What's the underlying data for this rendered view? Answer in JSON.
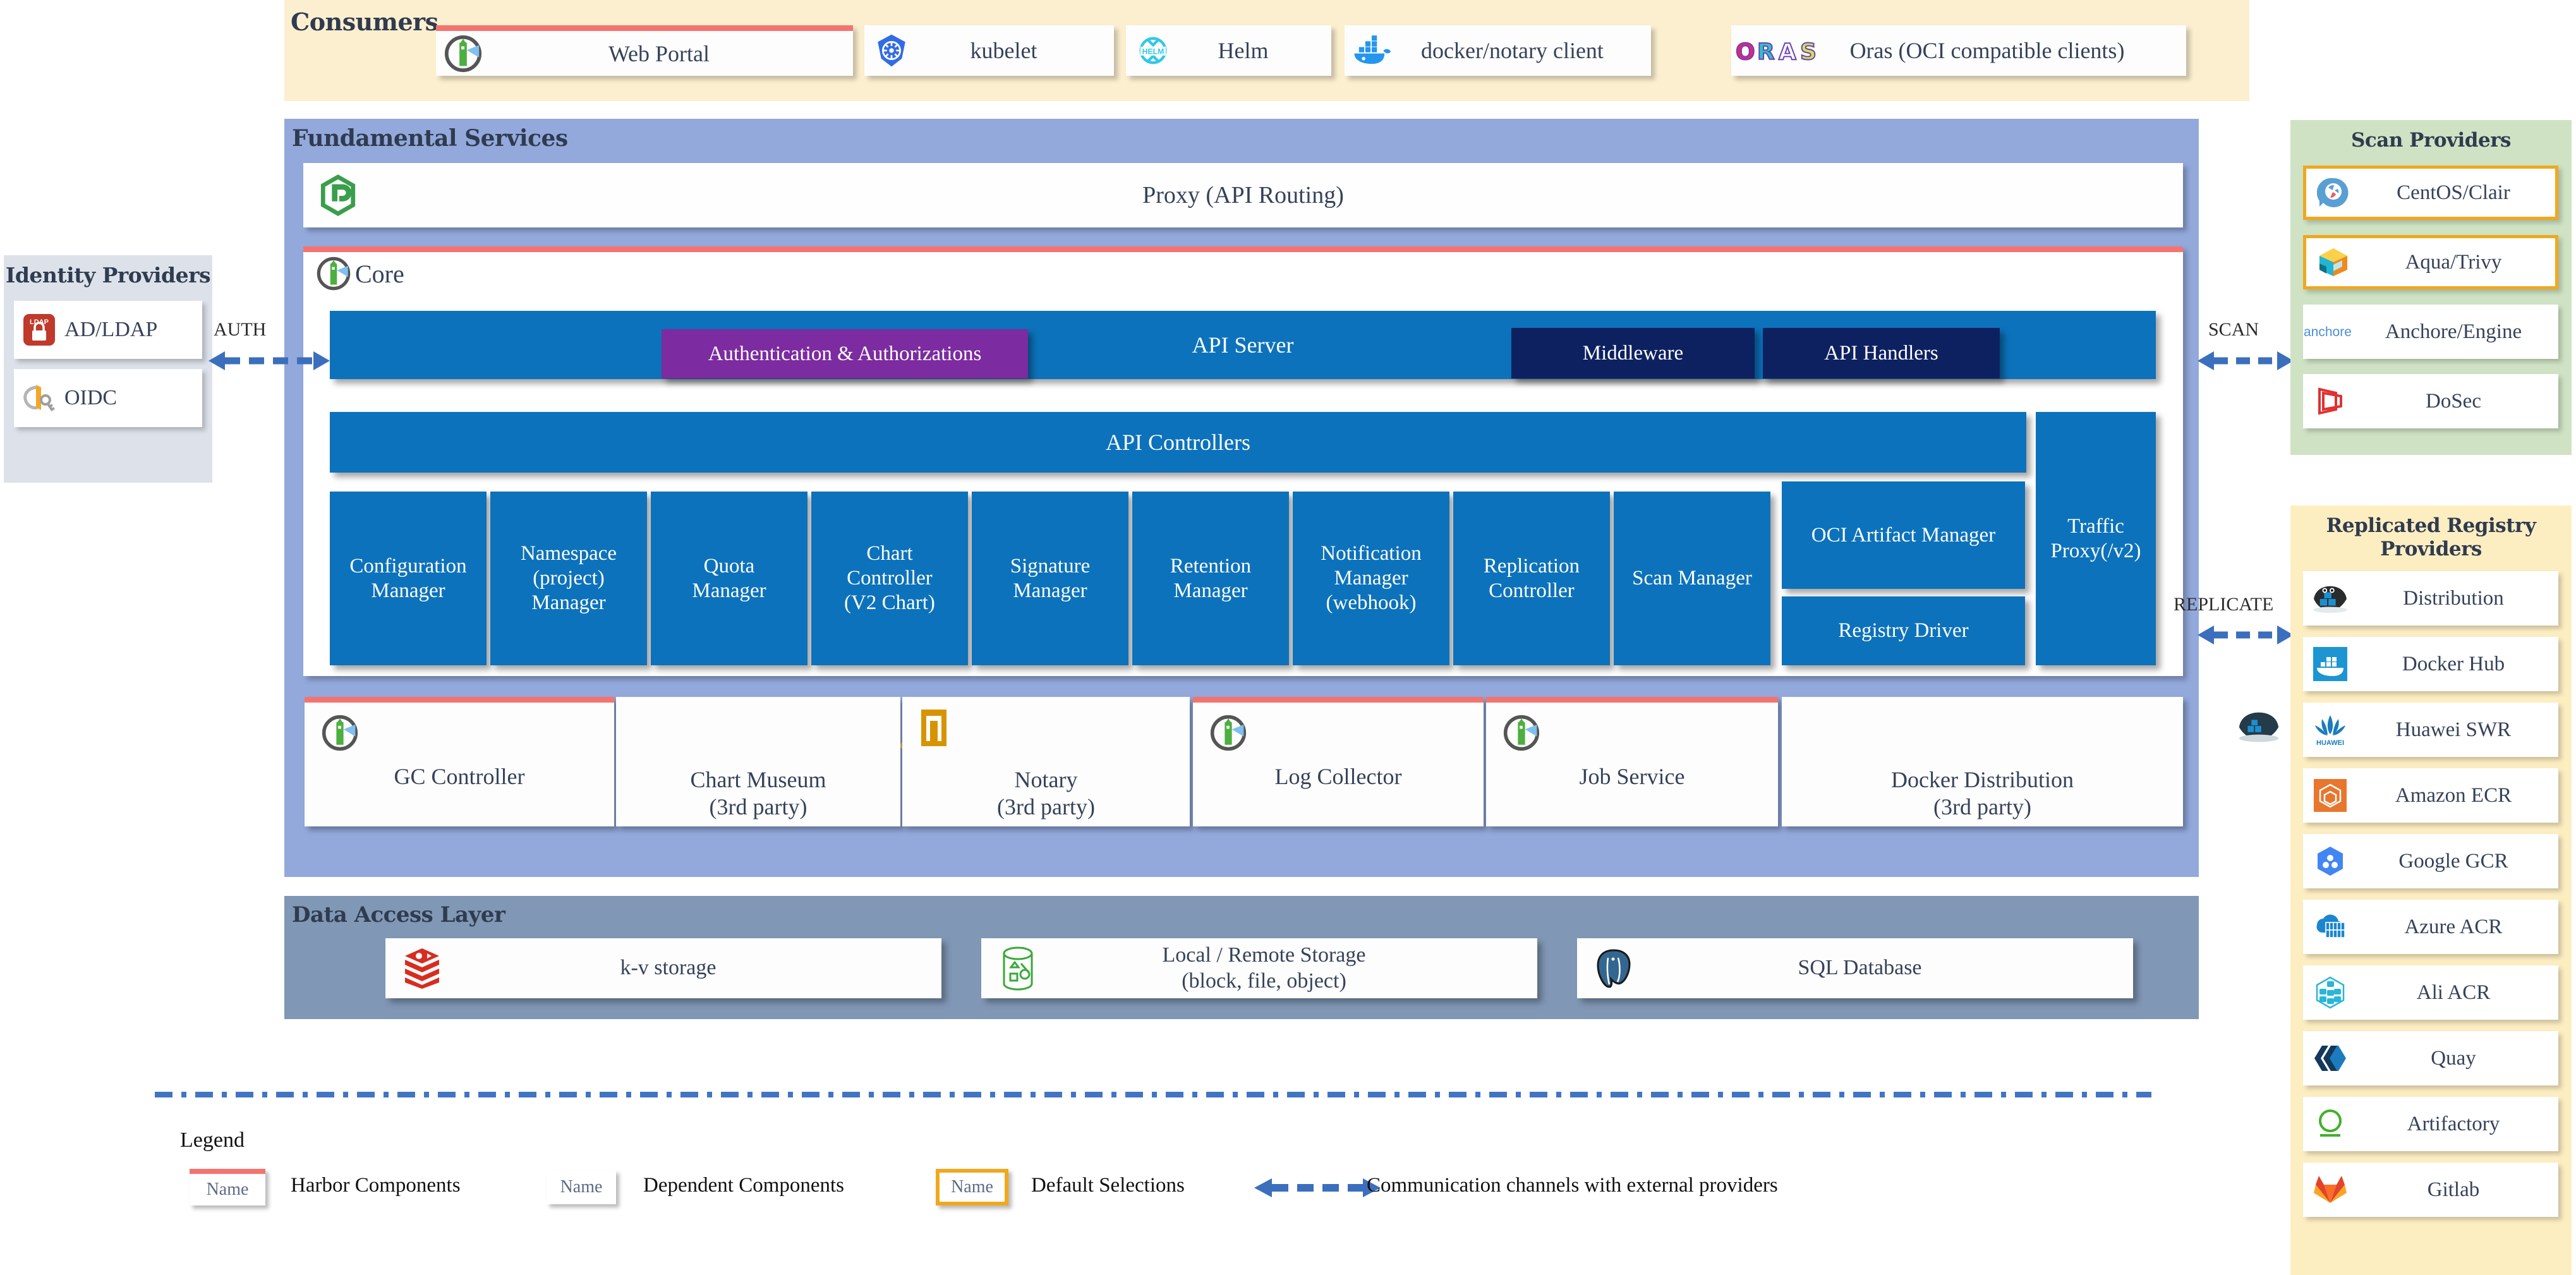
{
  "consumers": {
    "title": "Consumers",
    "items": [
      {
        "label": "Web Portal",
        "icon": "harbor-logo-icon",
        "harbor": true
      },
      {
        "label": "kubelet",
        "icon": "kubernetes-icon",
        "harbor": false
      },
      {
        "label": "Helm",
        "icon": "helm-icon",
        "harbor": false
      },
      {
        "label": "docker/notary client",
        "icon": "docker-whale-icon",
        "harbor": false
      },
      {
        "label": "Oras (OCI compatible clients)",
        "icon": "oras-icon",
        "harbor": false
      }
    ]
  },
  "fundamental": {
    "title": "Fundamental Services",
    "proxy": {
      "label": "Proxy (API Routing)",
      "icon": "nginx-icon"
    },
    "core": {
      "label": "Core",
      "icon": "harbor-logo-icon",
      "api_server": "API Server",
      "auth": "Authentication & Authorizations",
      "middleware": "Middleware",
      "api_handlers": "API Handlers",
      "api_controllers": "API Controllers",
      "managers": [
        "Configuration\nManager",
        "Namespace\n(project)\nManager",
        "Quota\nManager",
        "Chart\nController\n(V2 Chart)",
        "Signature\nManager",
        "Retention\nManager",
        "Notification\nManager\n(webhook)",
        "Replication\nController",
        "Scan Manager"
      ],
      "oci_artifact_manager": "OCI Artifact Manager",
      "registry_driver": "Registry Driver",
      "traffic_proxy": "Traffic\nProxy(/v2)"
    },
    "services": [
      {
        "label": "GC Controller",
        "icon": "harbor-logo-icon",
        "harbor": true
      },
      {
        "label": "Chart Museum\n(3rd party)",
        "icon": "chartmuseum-icon",
        "harbor": false
      },
      {
        "label": "Notary\n(3rd party)",
        "icon": "notary-icon",
        "harbor": false
      },
      {
        "label": "Log Collector",
        "icon": "harbor-logo-icon",
        "harbor": true
      },
      {
        "label": "Job Service",
        "icon": "harbor-logo-icon",
        "harbor": true
      },
      {
        "label": "Docker Distribution\n(3rd party)",
        "icon": "docker-distribution-icon",
        "harbor": false
      }
    ]
  },
  "data_access_layer": {
    "title": "Data Access Layer",
    "items": [
      {
        "label": "k-v storage",
        "icon": "redis-icon"
      },
      {
        "label": "Local / Remote Storage\n(block, file, object)",
        "icon": "storage-cylinder-icon"
      },
      {
        "label": "SQL Database",
        "icon": "postgresql-icon"
      }
    ]
  },
  "identity_providers": {
    "title": "Identity Providers",
    "items": [
      {
        "label": "AD/LDAP",
        "icon": "ldap-lock-icon"
      },
      {
        "label": "OIDC",
        "icon": "oidc-key-icon"
      }
    ]
  },
  "scan_providers": {
    "title": "Scan Providers",
    "items": [
      {
        "label": "CentOS/Clair",
        "icon": "clair-icon",
        "selected": true
      },
      {
        "label": "Aqua/Trivy",
        "icon": "aqua-trivy-icon",
        "selected": true
      },
      {
        "label": "Anchore/Engine",
        "icon": "anchore-icon",
        "selected": false
      },
      {
        "label": "DoSec",
        "icon": "dosec-icon",
        "selected": false
      }
    ]
  },
  "replicated_registry_providers": {
    "title": "Replicated Registry Providers",
    "items": [
      {
        "label": "Distribution",
        "icon": "distribution-icon"
      },
      {
        "label": "Docker Hub",
        "icon": "docker-hub-icon"
      },
      {
        "label": "Huawei SWR",
        "icon": "huawei-icon"
      },
      {
        "label": "Amazon ECR",
        "icon": "amazon-ecr-icon"
      },
      {
        "label": "Google GCR",
        "icon": "google-gcr-icon"
      },
      {
        "label": "Azure ACR",
        "icon": "azure-acr-icon"
      },
      {
        "label": "Ali ACR",
        "icon": "ali-acr-icon"
      },
      {
        "label": "Quay",
        "icon": "quay-icon"
      },
      {
        "label": "Artifactory",
        "icon": "artifactory-icon"
      },
      {
        "label": "Gitlab",
        "icon": "gitlab-icon"
      }
    ]
  },
  "channels": {
    "auth": "AUTH",
    "scan": "SCAN",
    "replicate": "REPLICATE"
  },
  "legend": {
    "title": "Legend",
    "chip_text": "Name",
    "harbor_components": "Harbor Components",
    "dependent_components": "Dependent Components",
    "default_selections": "Default Selections",
    "communication": "Communication channels with external providers"
  },
  "colors": {
    "harbor_accent": "#f4736f",
    "selection_accent": "#f0a81f",
    "core_blue": "#0c72bb",
    "navy": "#0d2161",
    "purple": "#7c2ba0",
    "band_blue": "#93a9dc",
    "dal_blue": "#8097b5",
    "consumers_bg": "#fcefcf",
    "scan_bg": "#cfe3c4",
    "repl_bg": "#fdeec2",
    "arrow_blue": "#3b6fbd"
  }
}
